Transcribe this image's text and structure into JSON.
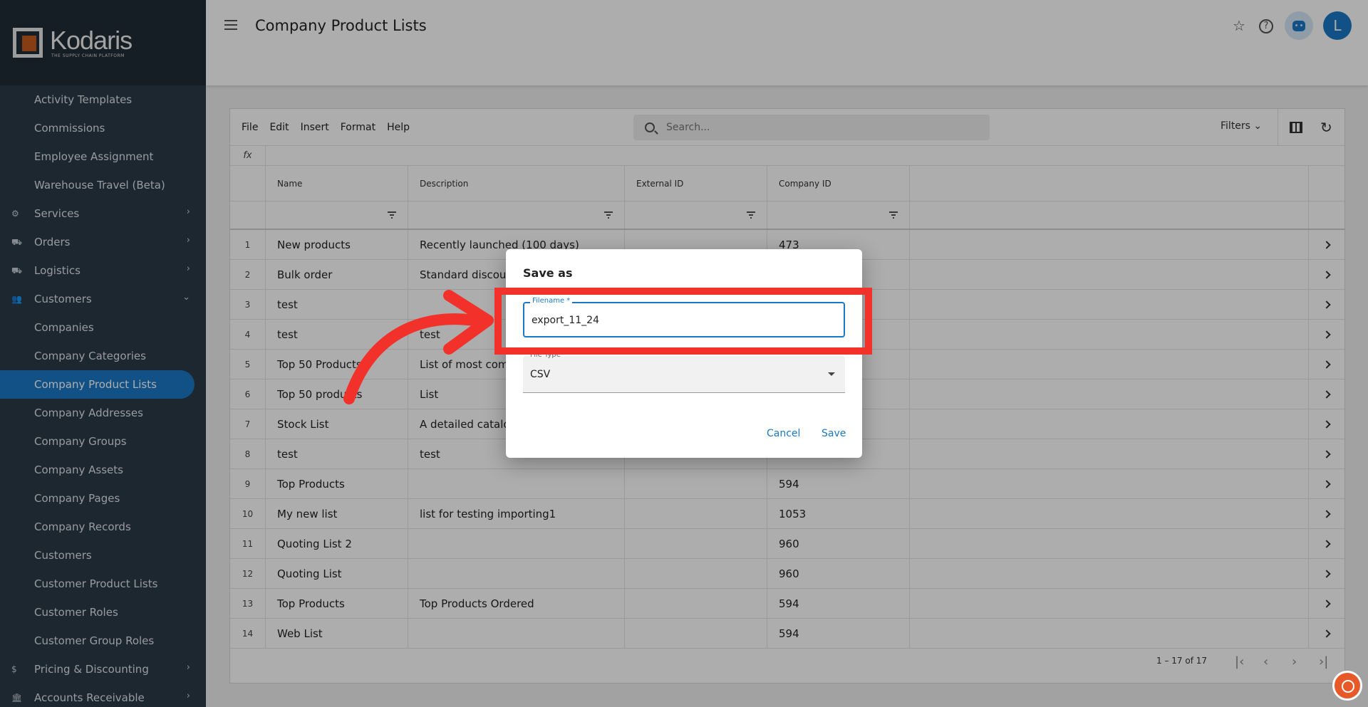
{
  "brand": {
    "name": "Kodaris",
    "tagline": "THE SUPPLY CHAIN PLATFORM"
  },
  "sidebar": {
    "items": [
      {
        "label": "Activity Templates",
        "type": "sub"
      },
      {
        "label": "Commissions",
        "type": "sub"
      },
      {
        "label": "Employee Assignment",
        "type": "sub"
      },
      {
        "label": "Warehouse Travel (Beta)",
        "type": "sub"
      },
      {
        "label": "Services",
        "type": "parent",
        "icon": "gears-icon",
        "glyph": "⚙",
        "chevron": "›"
      },
      {
        "label": "Orders",
        "type": "parent",
        "icon": "truck-icon",
        "glyph": "⛟",
        "chevron": "›"
      },
      {
        "label": "Logistics",
        "type": "parent",
        "icon": "shipping-icon",
        "glyph": "⛟",
        "chevron": "›"
      },
      {
        "label": "Customers",
        "type": "parent",
        "icon": "people-icon",
        "glyph": "👥",
        "chevron": "⌄"
      },
      {
        "label": "Companies",
        "type": "sub"
      },
      {
        "label": "Company Categories",
        "type": "sub"
      },
      {
        "label": "Company Product Lists",
        "type": "sub",
        "active": true
      },
      {
        "label": "Company Addresses",
        "type": "sub"
      },
      {
        "label": "Company Groups",
        "type": "sub"
      },
      {
        "label": "Company Assets",
        "type": "sub"
      },
      {
        "label": "Company Pages",
        "type": "sub"
      },
      {
        "label": "Company Records",
        "type": "sub"
      },
      {
        "label": "Customers",
        "type": "sub"
      },
      {
        "label": "Customer Product Lists",
        "type": "sub"
      },
      {
        "label": "Customer Roles",
        "type": "sub"
      },
      {
        "label": "Customer Group Roles",
        "type": "sub"
      },
      {
        "label": "Pricing & Discounting",
        "type": "parent",
        "icon": "dollar-icon",
        "glyph": "$",
        "chevron": "›"
      },
      {
        "label": "Accounts Receivable",
        "type": "parent",
        "icon": "bank-icon",
        "glyph": "🏛",
        "chevron": "›"
      }
    ]
  },
  "header": {
    "title": "Company Product Lists",
    "avatar_letter": "L"
  },
  "toolbar": {
    "menus": [
      "File",
      "Edit",
      "Insert",
      "Format",
      "Help"
    ],
    "search_placeholder": "Search...",
    "filters_label": "Filters"
  },
  "grid": {
    "fx": "fx",
    "columns": [
      "Name",
      "Description",
      "External ID",
      "Company ID"
    ],
    "rows": [
      {
        "n": "1",
        "name": "New products",
        "desc": "Recently launched (100 days)",
        "ext": "",
        "comp": "473"
      },
      {
        "n": "2",
        "name": "Bulk order",
        "desc": "Standard discounts",
        "ext": "",
        "comp": ""
      },
      {
        "n": "3",
        "name": "test",
        "desc": "",
        "ext": "",
        "comp": ""
      },
      {
        "n": "4",
        "name": "test",
        "desc": "test",
        "ext": "",
        "comp": ""
      },
      {
        "n": "5",
        "name": "Top 50 Products",
        "desc": "List of most common",
        "ext": "",
        "comp": ""
      },
      {
        "n": "6",
        "name": "Top 50 products",
        "desc": "List",
        "ext": "",
        "comp": ""
      },
      {
        "n": "7",
        "name": "Stock List",
        "desc": "A detailed catalog",
        "ext": "",
        "comp": ""
      },
      {
        "n": "8",
        "name": "test",
        "desc": "test",
        "ext": "",
        "comp": ""
      },
      {
        "n": "9",
        "name": "Top Products",
        "desc": "",
        "ext": "",
        "comp": "594"
      },
      {
        "n": "10",
        "name": "My new list",
        "desc": "list for testing importing1",
        "ext": "",
        "comp": "1053"
      },
      {
        "n": "11",
        "name": "Quoting List 2",
        "desc": "",
        "ext": "",
        "comp": "960"
      },
      {
        "n": "12",
        "name": "Quoting List",
        "desc": "",
        "ext": "",
        "comp": "960"
      },
      {
        "n": "13",
        "name": "Top Products",
        "desc": "Top Products Ordered",
        "ext": "",
        "comp": "594"
      },
      {
        "n": "14",
        "name": "Web List",
        "desc": "",
        "ext": "",
        "comp": "594"
      }
    ],
    "pagination": "1 – 17 of 17"
  },
  "dialog": {
    "title": "Save as",
    "filename_label": "Filename *",
    "filename_value": "export_11_24",
    "filetype_label": "File Type",
    "filetype_value": "CSV",
    "cancel_label": "Cancel",
    "save_label": "Save"
  },
  "colors": {
    "accent": "#1b78c4",
    "annotation": "#f2312a",
    "sidebar": "#2b3a48"
  }
}
